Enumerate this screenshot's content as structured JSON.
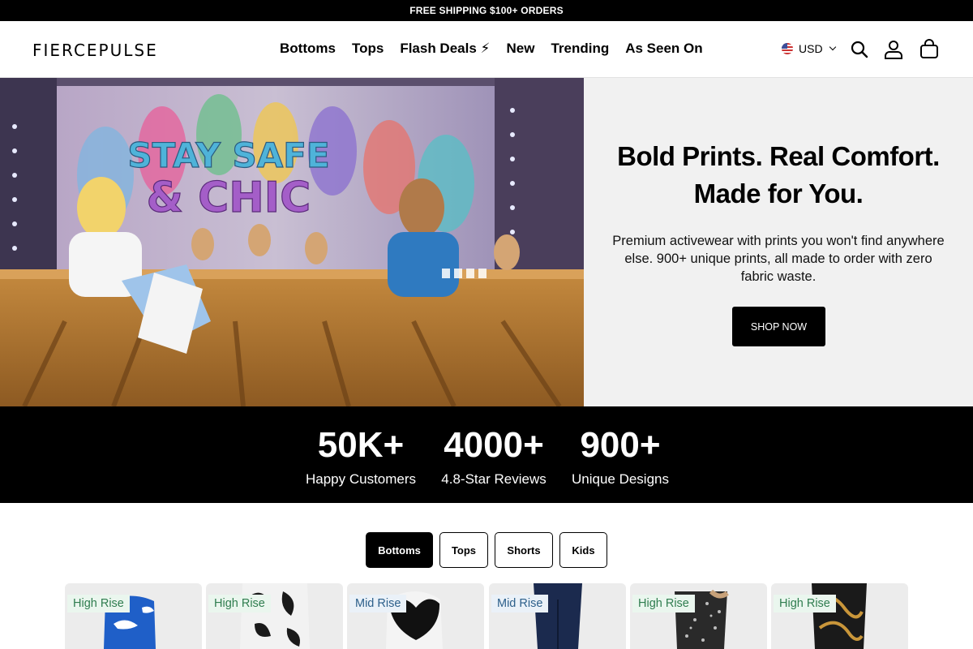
{
  "announcement": "FREE SHIPPING $100+ ORDERS",
  "header": {
    "logo": "FIERCEPULSE",
    "nav": [
      "Bottoms",
      "Tops",
      "Flash Deals ⚡",
      "New",
      "Trending",
      "As Seen On"
    ],
    "currency": "USD"
  },
  "hero": {
    "image_text_line1": "STAY SAFE",
    "image_text_line2": "& CHIC",
    "title_line1": "Bold Prints. Real Comfort.",
    "title_line2": "Made for You.",
    "subtitle": "Premium activewear with prints you won't find anywhere else. 900+ unique prints, all made to order with zero fabric waste.",
    "cta": "SHOP NOW"
  },
  "stats": [
    {
      "num": "50K+",
      "label": "Happy Customers"
    },
    {
      "num": "4000+",
      "label": "4.8-Star Reviews"
    },
    {
      "num": "900+",
      "label": "Unique Designs"
    }
  ],
  "tabs": [
    "Bottoms",
    "Tops",
    "Shorts",
    "Kids"
  ],
  "products": [
    {
      "badge": "High Rise"
    },
    {
      "badge": "High Rise"
    },
    {
      "badge": "Mid Rise"
    },
    {
      "badge": "Mid Rise"
    },
    {
      "badge": "High Rise"
    },
    {
      "badge": "High Rise"
    }
  ],
  "colors": {
    "black": "#000000",
    "hero_panel": "#f1f1f1",
    "high_rise_badge": "#2f7d4f",
    "mid_rise_badge": "#2c5f8a"
  }
}
